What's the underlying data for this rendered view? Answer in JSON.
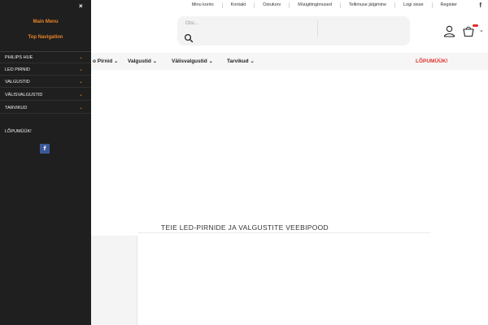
{
  "top_links": [
    "Minu konto",
    "Kontakt",
    "Ostukorv",
    "Müügitingimused",
    "Tellimuse jälgimine",
    "Logi sisse",
    "Register"
  ],
  "top_social": "f",
  "search": {
    "placeholder": "Otsi..."
  },
  "nav": {
    "items": [
      "o Pirnid",
      "Valgustid",
      "Välisvalgustid",
      "Tarvikud"
    ],
    "sale": "LÕPUMÜÜK!"
  },
  "hero": {
    "title": "TEIE LED-PIRNIDE JA VALGUSTITE VEEBIPOOD"
  },
  "sidebar": {
    "close": "×",
    "main_menu": "Main Menu",
    "top_navigation": "Top Navigation",
    "items": [
      "PHILIPS HUE",
      "LED PIRNID",
      "VALGUSTID",
      "VÄLISVALGUSTID",
      "TARVIKUD"
    ],
    "sale": "LÕPUMÜÜK!",
    "facebook": "f"
  },
  "colors": {
    "accent": "#e8842a",
    "sale": "#e0302b",
    "sidebar_bg": "#1f1f1f",
    "facebook": "#3b5998"
  }
}
